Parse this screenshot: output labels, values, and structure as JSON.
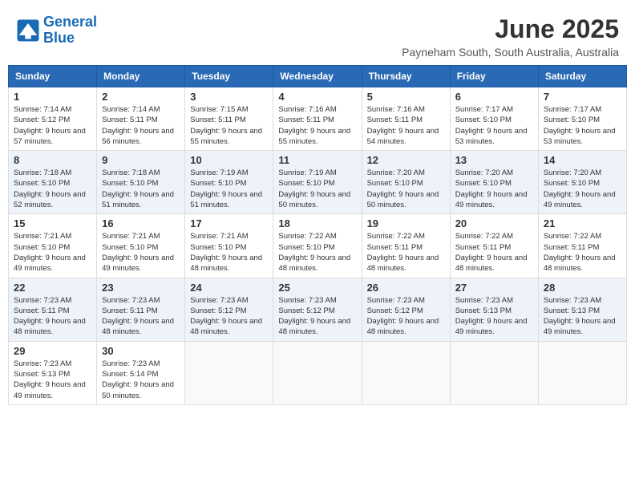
{
  "header": {
    "logo_line1": "General",
    "logo_line2": "Blue",
    "month_title": "June 2025",
    "location": "Payneham South, South Australia, Australia"
  },
  "weekdays": [
    "Sunday",
    "Monday",
    "Tuesday",
    "Wednesday",
    "Thursday",
    "Friday",
    "Saturday"
  ],
  "days": [
    {
      "date": 1,
      "col": 0,
      "sunrise": "7:14 AM",
      "sunset": "5:12 PM",
      "daylight": "9 hours and 57 minutes."
    },
    {
      "date": 2,
      "col": 1,
      "sunrise": "7:14 AM",
      "sunset": "5:11 PM",
      "daylight": "9 hours and 56 minutes."
    },
    {
      "date": 3,
      "col": 2,
      "sunrise": "7:15 AM",
      "sunset": "5:11 PM",
      "daylight": "9 hours and 55 minutes."
    },
    {
      "date": 4,
      "col": 3,
      "sunrise": "7:16 AM",
      "sunset": "5:11 PM",
      "daylight": "9 hours and 55 minutes."
    },
    {
      "date": 5,
      "col": 4,
      "sunrise": "7:16 AM",
      "sunset": "5:11 PM",
      "daylight": "9 hours and 54 minutes."
    },
    {
      "date": 6,
      "col": 5,
      "sunrise": "7:17 AM",
      "sunset": "5:10 PM",
      "daylight": "9 hours and 53 minutes."
    },
    {
      "date": 7,
      "col": 6,
      "sunrise": "7:17 AM",
      "sunset": "5:10 PM",
      "daylight": "9 hours and 53 minutes."
    },
    {
      "date": 8,
      "col": 0,
      "sunrise": "7:18 AM",
      "sunset": "5:10 PM",
      "daylight": "9 hours and 52 minutes."
    },
    {
      "date": 9,
      "col": 1,
      "sunrise": "7:18 AM",
      "sunset": "5:10 PM",
      "daylight": "9 hours and 51 minutes."
    },
    {
      "date": 10,
      "col": 2,
      "sunrise": "7:19 AM",
      "sunset": "5:10 PM",
      "daylight": "9 hours and 51 minutes."
    },
    {
      "date": 11,
      "col": 3,
      "sunrise": "7:19 AM",
      "sunset": "5:10 PM",
      "daylight": "9 hours and 50 minutes."
    },
    {
      "date": 12,
      "col": 4,
      "sunrise": "7:20 AM",
      "sunset": "5:10 PM",
      "daylight": "9 hours and 50 minutes."
    },
    {
      "date": 13,
      "col": 5,
      "sunrise": "7:20 AM",
      "sunset": "5:10 PM",
      "daylight": "9 hours and 49 minutes."
    },
    {
      "date": 14,
      "col": 6,
      "sunrise": "7:20 AM",
      "sunset": "5:10 PM",
      "daylight": "9 hours and 49 minutes."
    },
    {
      "date": 15,
      "col": 0,
      "sunrise": "7:21 AM",
      "sunset": "5:10 PM",
      "daylight": "9 hours and 49 minutes."
    },
    {
      "date": 16,
      "col": 1,
      "sunrise": "7:21 AM",
      "sunset": "5:10 PM",
      "daylight": "9 hours and 49 minutes."
    },
    {
      "date": 17,
      "col": 2,
      "sunrise": "7:21 AM",
      "sunset": "5:10 PM",
      "daylight": "9 hours and 48 minutes."
    },
    {
      "date": 18,
      "col": 3,
      "sunrise": "7:22 AM",
      "sunset": "5:10 PM",
      "daylight": "9 hours and 48 minutes."
    },
    {
      "date": 19,
      "col": 4,
      "sunrise": "7:22 AM",
      "sunset": "5:11 PM",
      "daylight": "9 hours and 48 minutes."
    },
    {
      "date": 20,
      "col": 5,
      "sunrise": "7:22 AM",
      "sunset": "5:11 PM",
      "daylight": "9 hours and 48 minutes."
    },
    {
      "date": 21,
      "col": 6,
      "sunrise": "7:22 AM",
      "sunset": "5:11 PM",
      "daylight": "9 hours and 48 minutes."
    },
    {
      "date": 22,
      "col": 0,
      "sunrise": "7:23 AM",
      "sunset": "5:11 PM",
      "daylight": "9 hours and 48 minutes."
    },
    {
      "date": 23,
      "col": 1,
      "sunrise": "7:23 AM",
      "sunset": "5:11 PM",
      "daylight": "9 hours and 48 minutes."
    },
    {
      "date": 24,
      "col": 2,
      "sunrise": "7:23 AM",
      "sunset": "5:12 PM",
      "daylight": "9 hours and 48 minutes."
    },
    {
      "date": 25,
      "col": 3,
      "sunrise": "7:23 AM",
      "sunset": "5:12 PM",
      "daylight": "9 hours and 48 minutes."
    },
    {
      "date": 26,
      "col": 4,
      "sunrise": "7:23 AM",
      "sunset": "5:12 PM",
      "daylight": "9 hours and 48 minutes."
    },
    {
      "date": 27,
      "col": 5,
      "sunrise": "7:23 AM",
      "sunset": "5:13 PM",
      "daylight": "9 hours and 49 minutes."
    },
    {
      "date": 28,
      "col": 6,
      "sunrise": "7:23 AM",
      "sunset": "5:13 PM",
      "daylight": "9 hours and 49 minutes."
    },
    {
      "date": 29,
      "col": 0,
      "sunrise": "7:23 AM",
      "sunset": "5:13 PM",
      "daylight": "9 hours and 49 minutes."
    },
    {
      "date": 30,
      "col": 1,
      "sunrise": "7:23 AM",
      "sunset": "5:14 PM",
      "daylight": "9 hours and 50 minutes."
    }
  ]
}
